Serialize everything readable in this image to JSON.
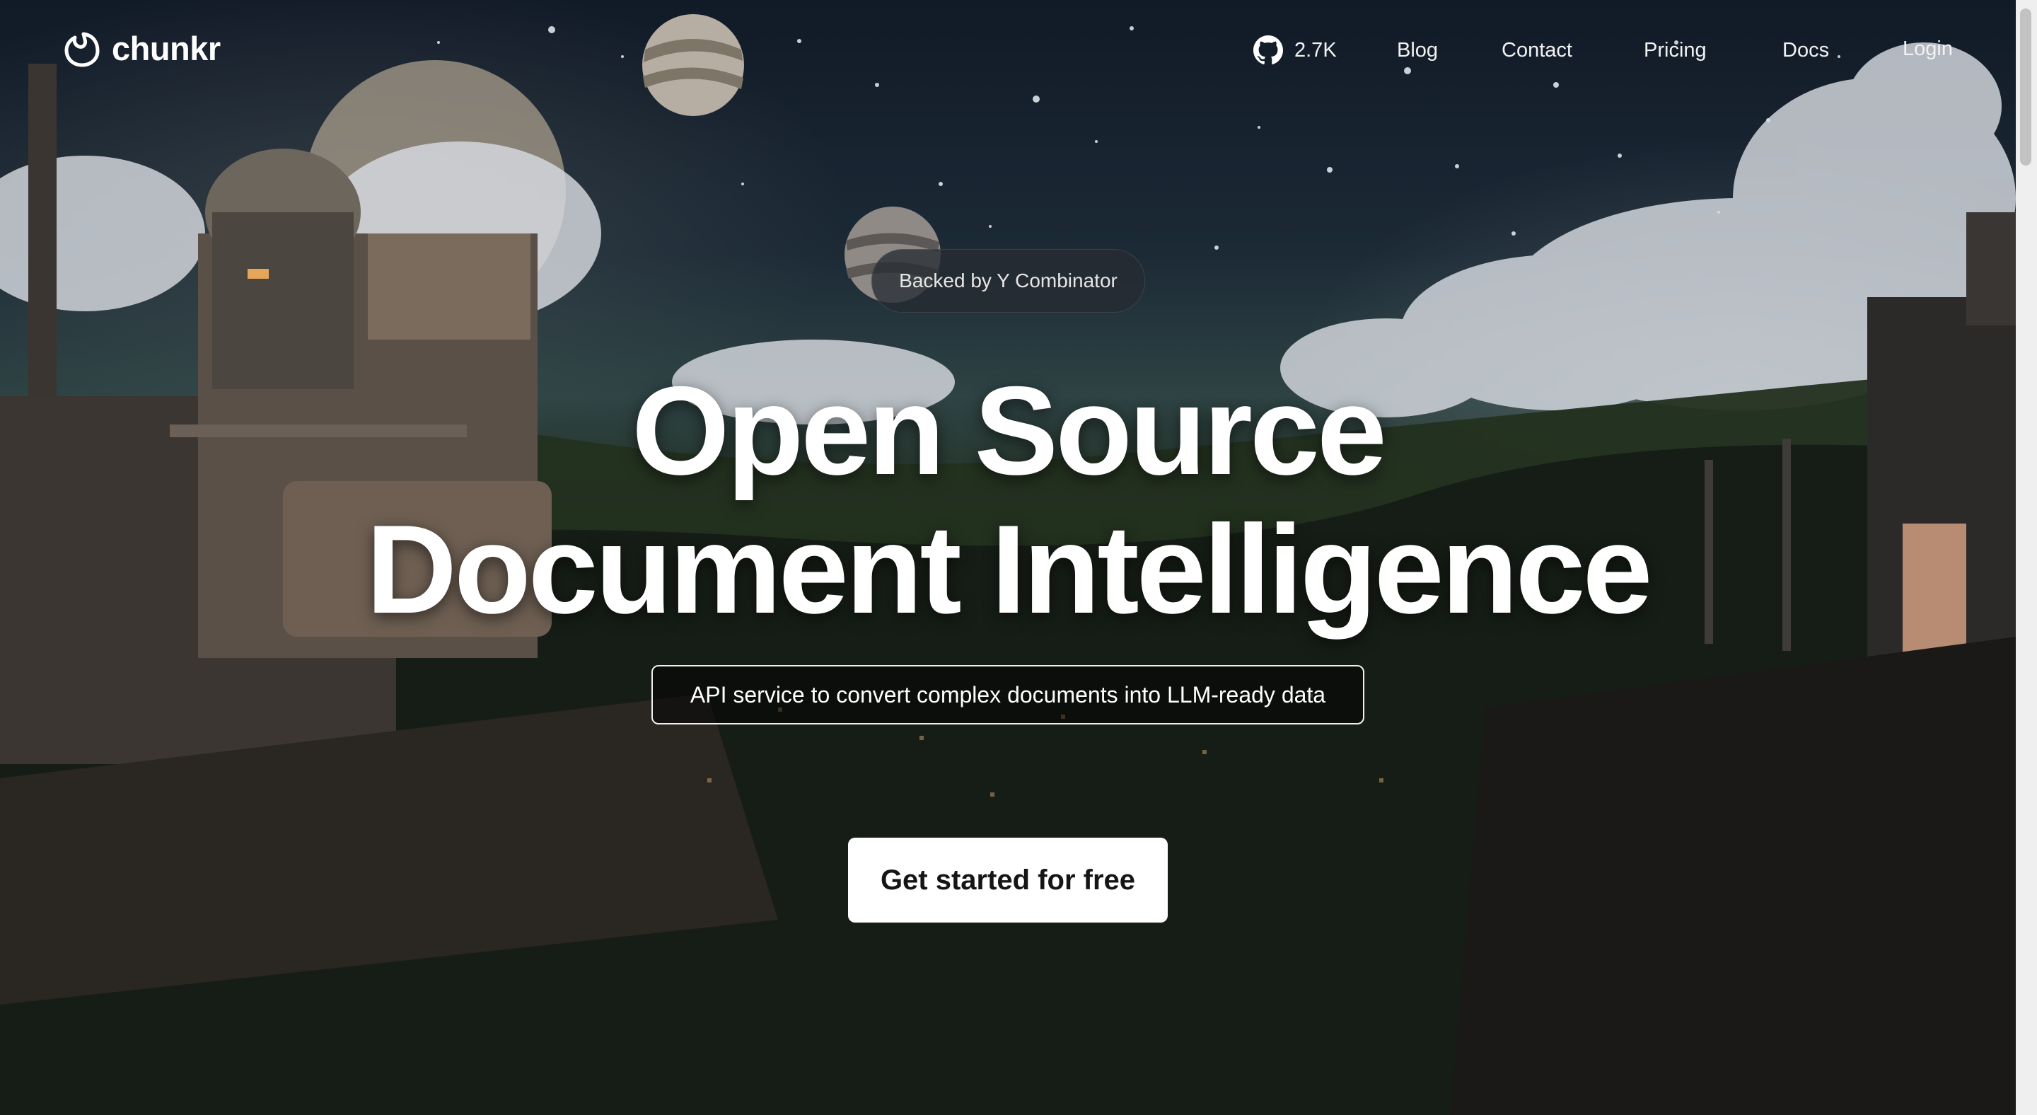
{
  "brand": {
    "name": "chunkr",
    "logo_icon": "chunkr-logo-icon"
  },
  "nav": {
    "github": {
      "icon": "github-icon",
      "stars": "2.7K"
    },
    "links": [
      "Blog",
      "Contact",
      "Pricing",
      "Docs",
      "Login"
    ]
  },
  "hero": {
    "badge": "Backed by Y Combinator",
    "headline_line1": "Open Source",
    "headline_line2": "Document Intelligence",
    "subtitle": "API service to convert complex documents into LLM-ready data",
    "cta": "Get started for free"
  },
  "colors": {
    "cta_background": "#ffffff",
    "cta_text": "#151515",
    "headline": "#ffffff",
    "page_bottom": "#07080a"
  }
}
